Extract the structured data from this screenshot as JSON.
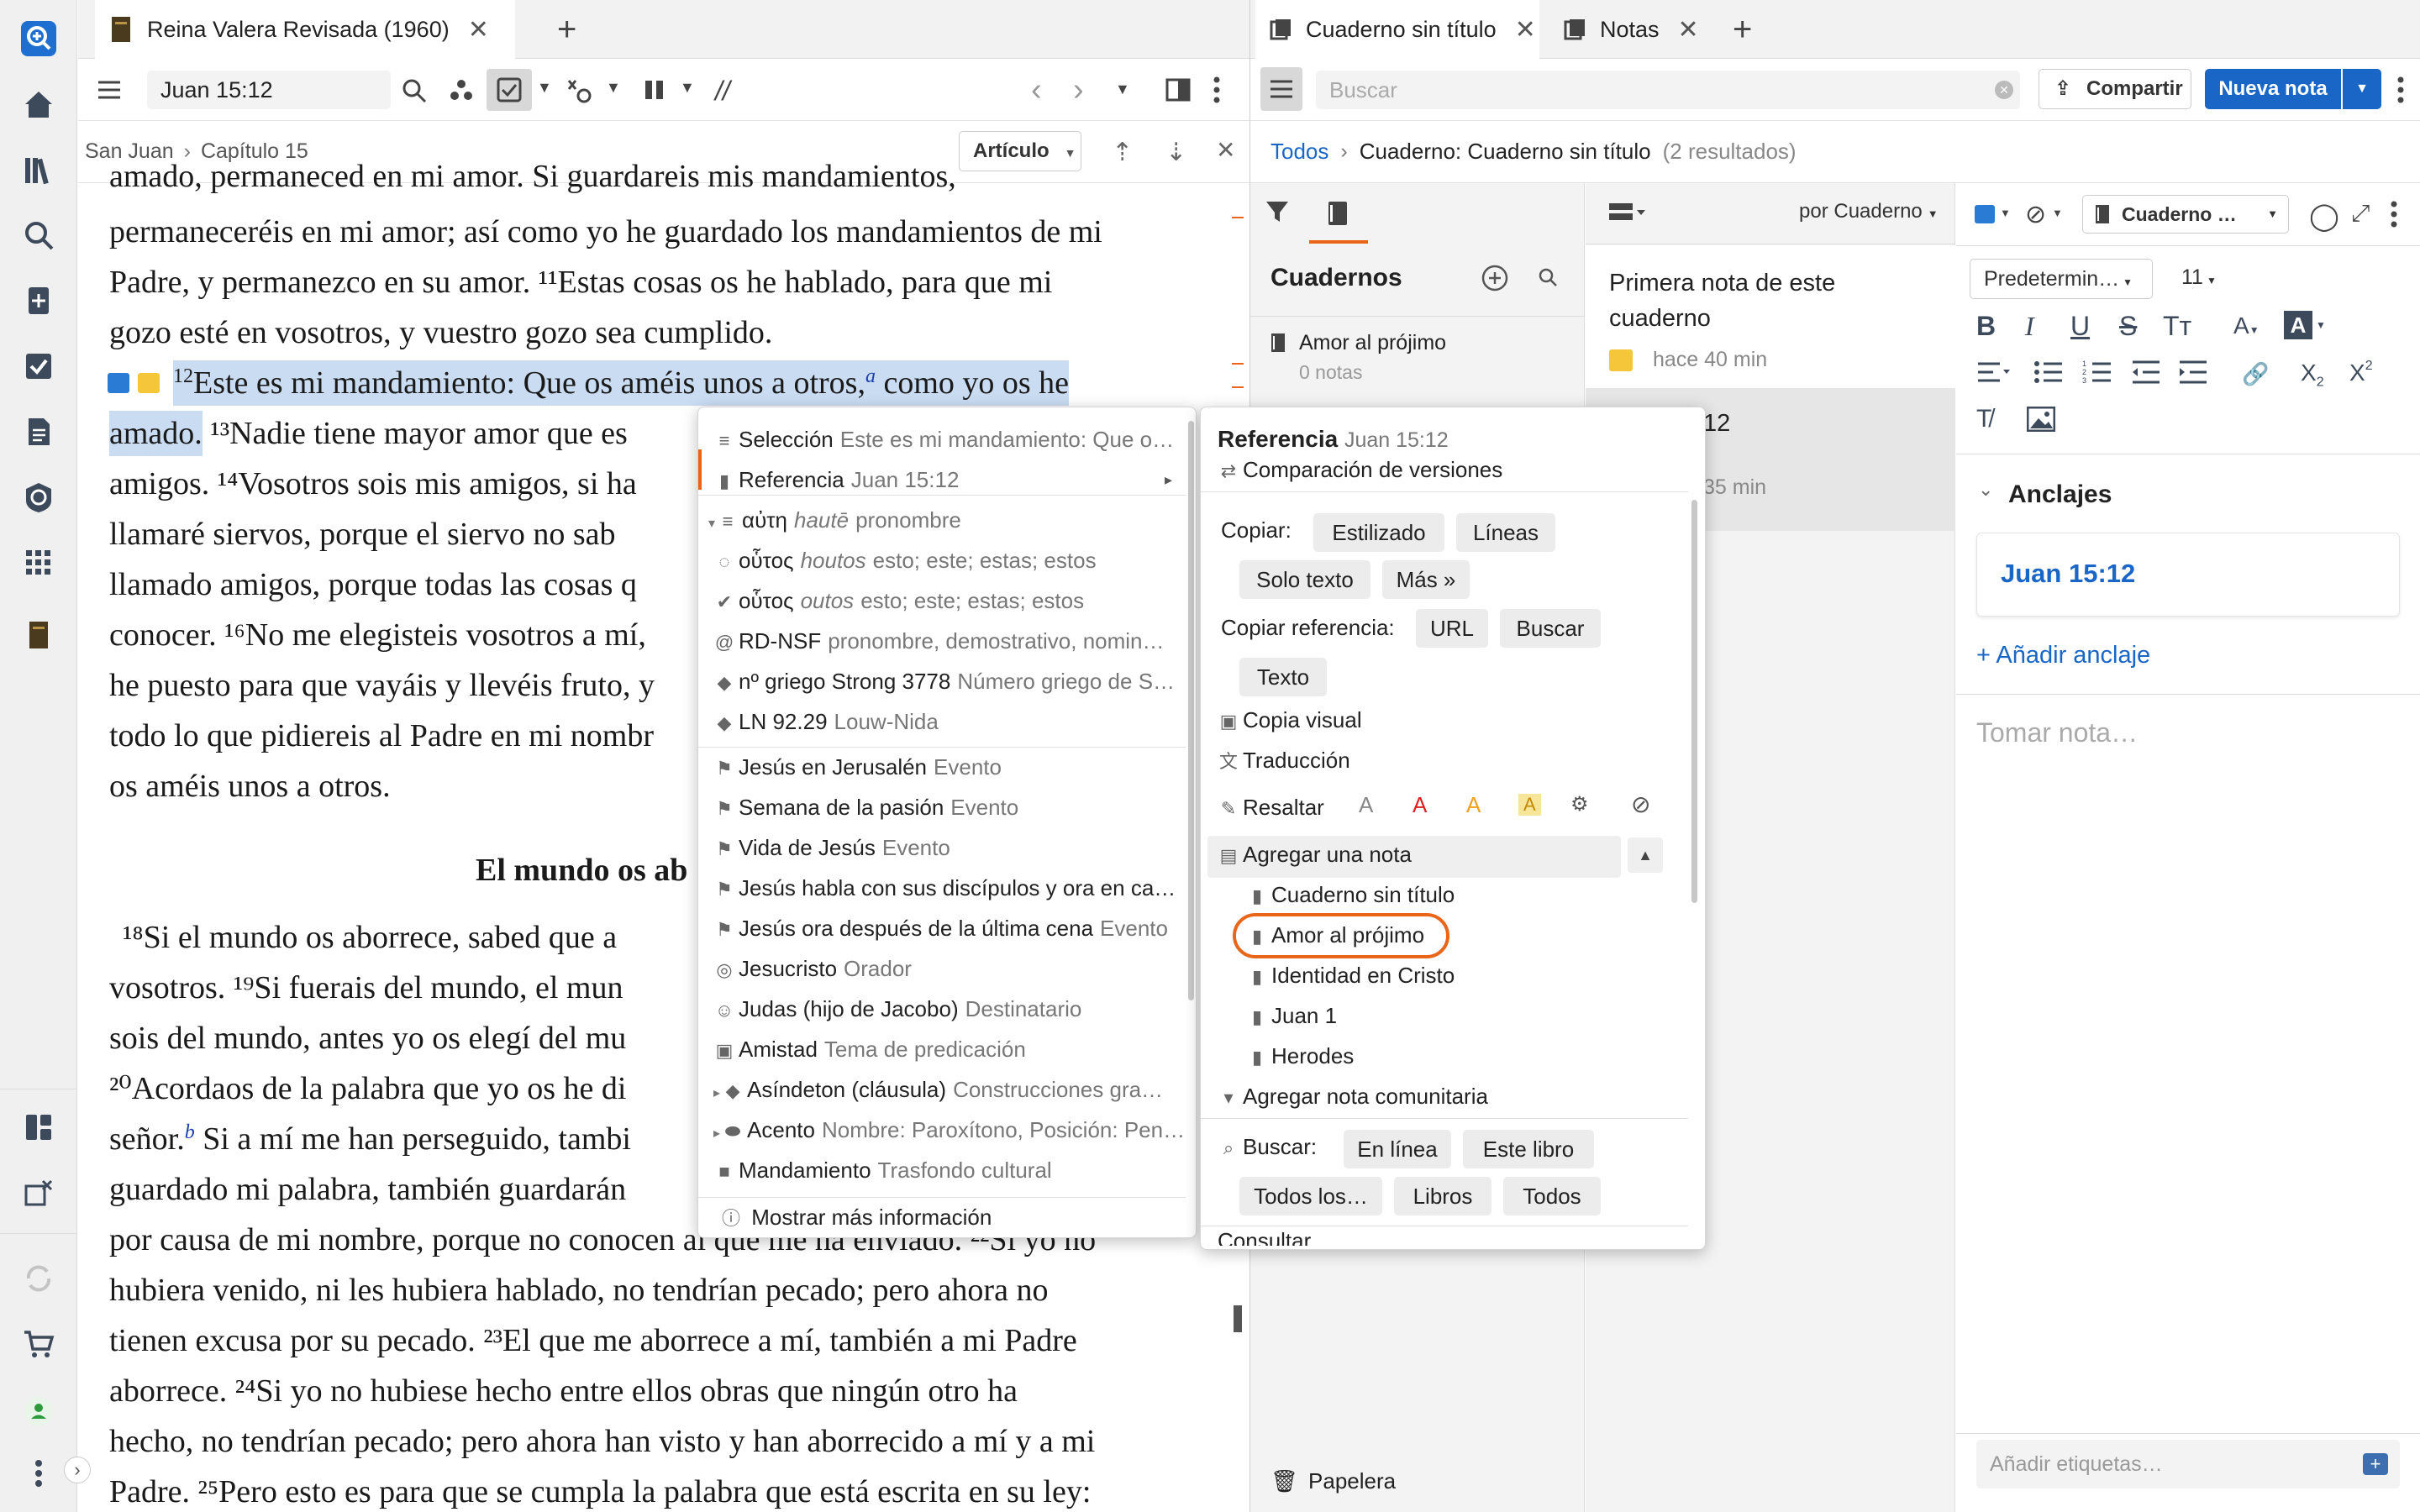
{
  "left_tab": {
    "title": "Reina Valera Revisada (1960)"
  },
  "toolbar": {
    "reference": "Juan 15:12"
  },
  "breadcrumb": {
    "book": "San Juan",
    "chapter": "Capítulo 15",
    "section_select": "Artículo"
  },
  "text": {
    "lines": [
      "amado, permaneced en mi amor. Si guardareis mis mandamientos,",
      "permaneceréis en mi amor; así como yo he guardado los mandamientos de mi",
      "Padre, y permanezco en su amor. ¹¹Estas cosas os he hablado, para que mi",
      "gozo esté en vosotros, y vuestro gozo sea cumplido."
    ],
    "v12_num": "12",
    "v12_text": "Este es mi mandamiento: Que os améis unos a otros,",
    "v12_note": "a",
    "v12_rest": " como yo os he",
    "v12_line2": "amado.",
    "v13": "¹³Nadie tiene mayor amor que es",
    "lines2": [
      "amigos. ¹⁴Vosotros sois mis amigos, si ha",
      "llamaré siervos, porque el siervo no sab",
      "llamado amigos, porque todas las cosas q",
      "conocer. ¹⁶No me elegisteis vosotros a mí,",
      "he puesto para que vayáis y llevéis fruto, y",
      "todo lo que pidiereis al Padre en mi nombr",
      "os améis unos a otros."
    ],
    "heading": "El mundo os ab",
    "lines3": [
      "¹⁸Si el mundo os aborrece, sabed que a",
      "vosotros. ¹⁹Si fuerais del mundo, el mun",
      "sois del mundo, antes yo os elegí del mu",
      "²⁰Acordaos de la palabra que yo os he di",
      "señor.",
      "guardado mi palabra, también guardarán",
      "por causa de mi nombre, porque no conocen al que me ha enviado. ²²Si yo no",
      "hubiera venido, ni les hubiera hablado, no tendrían pecado; pero ahora no",
      "tienen excusa por su pecado. ²³El que me aborrece a mí, también a mi Padre",
      "aborrece. ²⁴Si yo no hubiese hecho entre ellos obras que ningún otro ha",
      "hecho, no tendrían pecado; pero ahora han visto y han aborrecido a mí y a mi",
      "Padre. ²⁵Pero esto es para que se cumpla la palabra que está escrita en su ley:"
    ],
    "v20_note": "b",
    "v20_rest": " Si a mí me han perseguido, tambi"
  },
  "context_menu": {
    "items": [
      {
        "label": "Selección",
        "sub": "Este es mi mandamiento: Que o…",
        "icon": "list"
      },
      {
        "label": "Referencia",
        "sub": "Juan 15:12",
        "icon": "bookmark"
      },
      {
        "label": "αὐτη",
        "sub_i": "hautē",
        "sub": "pronombre",
        "icon": "list"
      },
      {
        "label": "οὗτος",
        "sub_i": "houtos",
        "sub": "esto; este; estas; estos",
        "icon": "refresh"
      },
      {
        "label": "οὗτος",
        "sub_i": "outos",
        "sub": "esto; este; estas; estos",
        "icon": "check"
      },
      {
        "label": "RD-NSF",
        "sub": "pronombre, demostrativo, nomin…",
        "icon": "at"
      },
      {
        "label": "nº griego Strong 3778",
        "sub": "Número griego de S…",
        "icon": "diamond"
      },
      {
        "label": "LN 92.29",
        "sub": "Louw-Nida",
        "icon": "diamond"
      },
      {
        "label": "Jesús en Jerusalén",
        "sub": "Evento",
        "icon": "flag"
      },
      {
        "label": "Semana de la pasión",
        "sub": "Evento",
        "icon": "flag"
      },
      {
        "label": "Vida de Jesús",
        "sub": "Evento",
        "icon": "flag"
      },
      {
        "label": "Jesús habla con sus discípulos y ora en ca…",
        "sub": "",
        "icon": "flag"
      },
      {
        "label": "Jesús ora después de la última cena",
        "sub": "Evento",
        "icon": "flag"
      },
      {
        "label": "Jesucristo",
        "sub": "Orador",
        "icon": "speaker"
      },
      {
        "label": "Judas (hijo de Jacobo)",
        "sub": "Destinatario",
        "icon": "person"
      },
      {
        "label": "Amistad",
        "sub": "Tema de predicación",
        "icon": "podium"
      },
      {
        "label": "Asíndeton (cláusula)",
        "sub": "Construcciones gra…",
        "icon": "diamond"
      },
      {
        "label": "Acento",
        "sub": "Nombre: Paroxítono, Posición: Pen…",
        "icon": "tag"
      },
      {
        "label": "Mandamiento",
        "sub": "Trasfondo cultural",
        "icon": "book"
      }
    ],
    "more": "Mostrar más información"
  },
  "ref_menu": {
    "title": "Referencia",
    "title_sub": "Juan 15:12",
    "compare": "Comparación de versiones",
    "copy_label": "Copiar:",
    "copy_buttons": [
      "Estilizado",
      "Líneas",
      "Solo texto",
      "Más »"
    ],
    "copyref_label": "Copiar referencia:",
    "copyref_buttons": [
      "URL",
      "Buscar",
      "Texto"
    ],
    "visual_copy": "Copia visual",
    "translate": "Traducción",
    "highlight": "Resaltar",
    "add_note": "Agregar una nota",
    "notebooks": [
      "Cuaderno sin título",
      "Amor al prójimo",
      "Identidad en Cristo",
      "Juan 1",
      "Herodes"
    ],
    "community_note": "Agregar nota comunitaria",
    "search_label": "Buscar:",
    "search_buttons": [
      "En línea",
      "Este libro",
      "Todos los…",
      "Libros",
      "Todos"
    ],
    "consult": "Consultar"
  },
  "right_tabs": {
    "notebook": "Cuaderno sin título",
    "notes": "Notas"
  },
  "notes_toolbar": {
    "search_placeholder": "Buscar",
    "share": "Compartir",
    "new_note": "Nueva nota"
  },
  "notes_bread": {
    "all": "Todos",
    "current": "Cuaderno: Cuaderno sin título",
    "count": "(2 resultados)"
  },
  "notebooks_panel": {
    "title": "Cuadernos",
    "items": [
      {
        "name": "Amor al prójimo",
        "count": "0 notas"
      }
    ],
    "trash": "Papelera"
  },
  "notes_list": {
    "sort": "por Cuaderno",
    "notes": [
      {
        "title": "Primera nota de este cuaderno",
        "time": "hace 40 min"
      },
      {
        "title": "12",
        "time": "35 min"
      }
    ]
  },
  "editor": {
    "notebook": "Cuaderno …",
    "style": "Predetermin…",
    "size": "11",
    "anchors_title": "Anclajes",
    "anchor": "Juan 15:12",
    "add_anchor": "+ Añadir anclaje",
    "note_placeholder": "Tomar nota…",
    "tags_placeholder": "Añadir etiquetas…"
  },
  "colors": {
    "accent": "#1a66c7",
    "highlight": "#c9dcf2",
    "orange": "#e8651a"
  }
}
